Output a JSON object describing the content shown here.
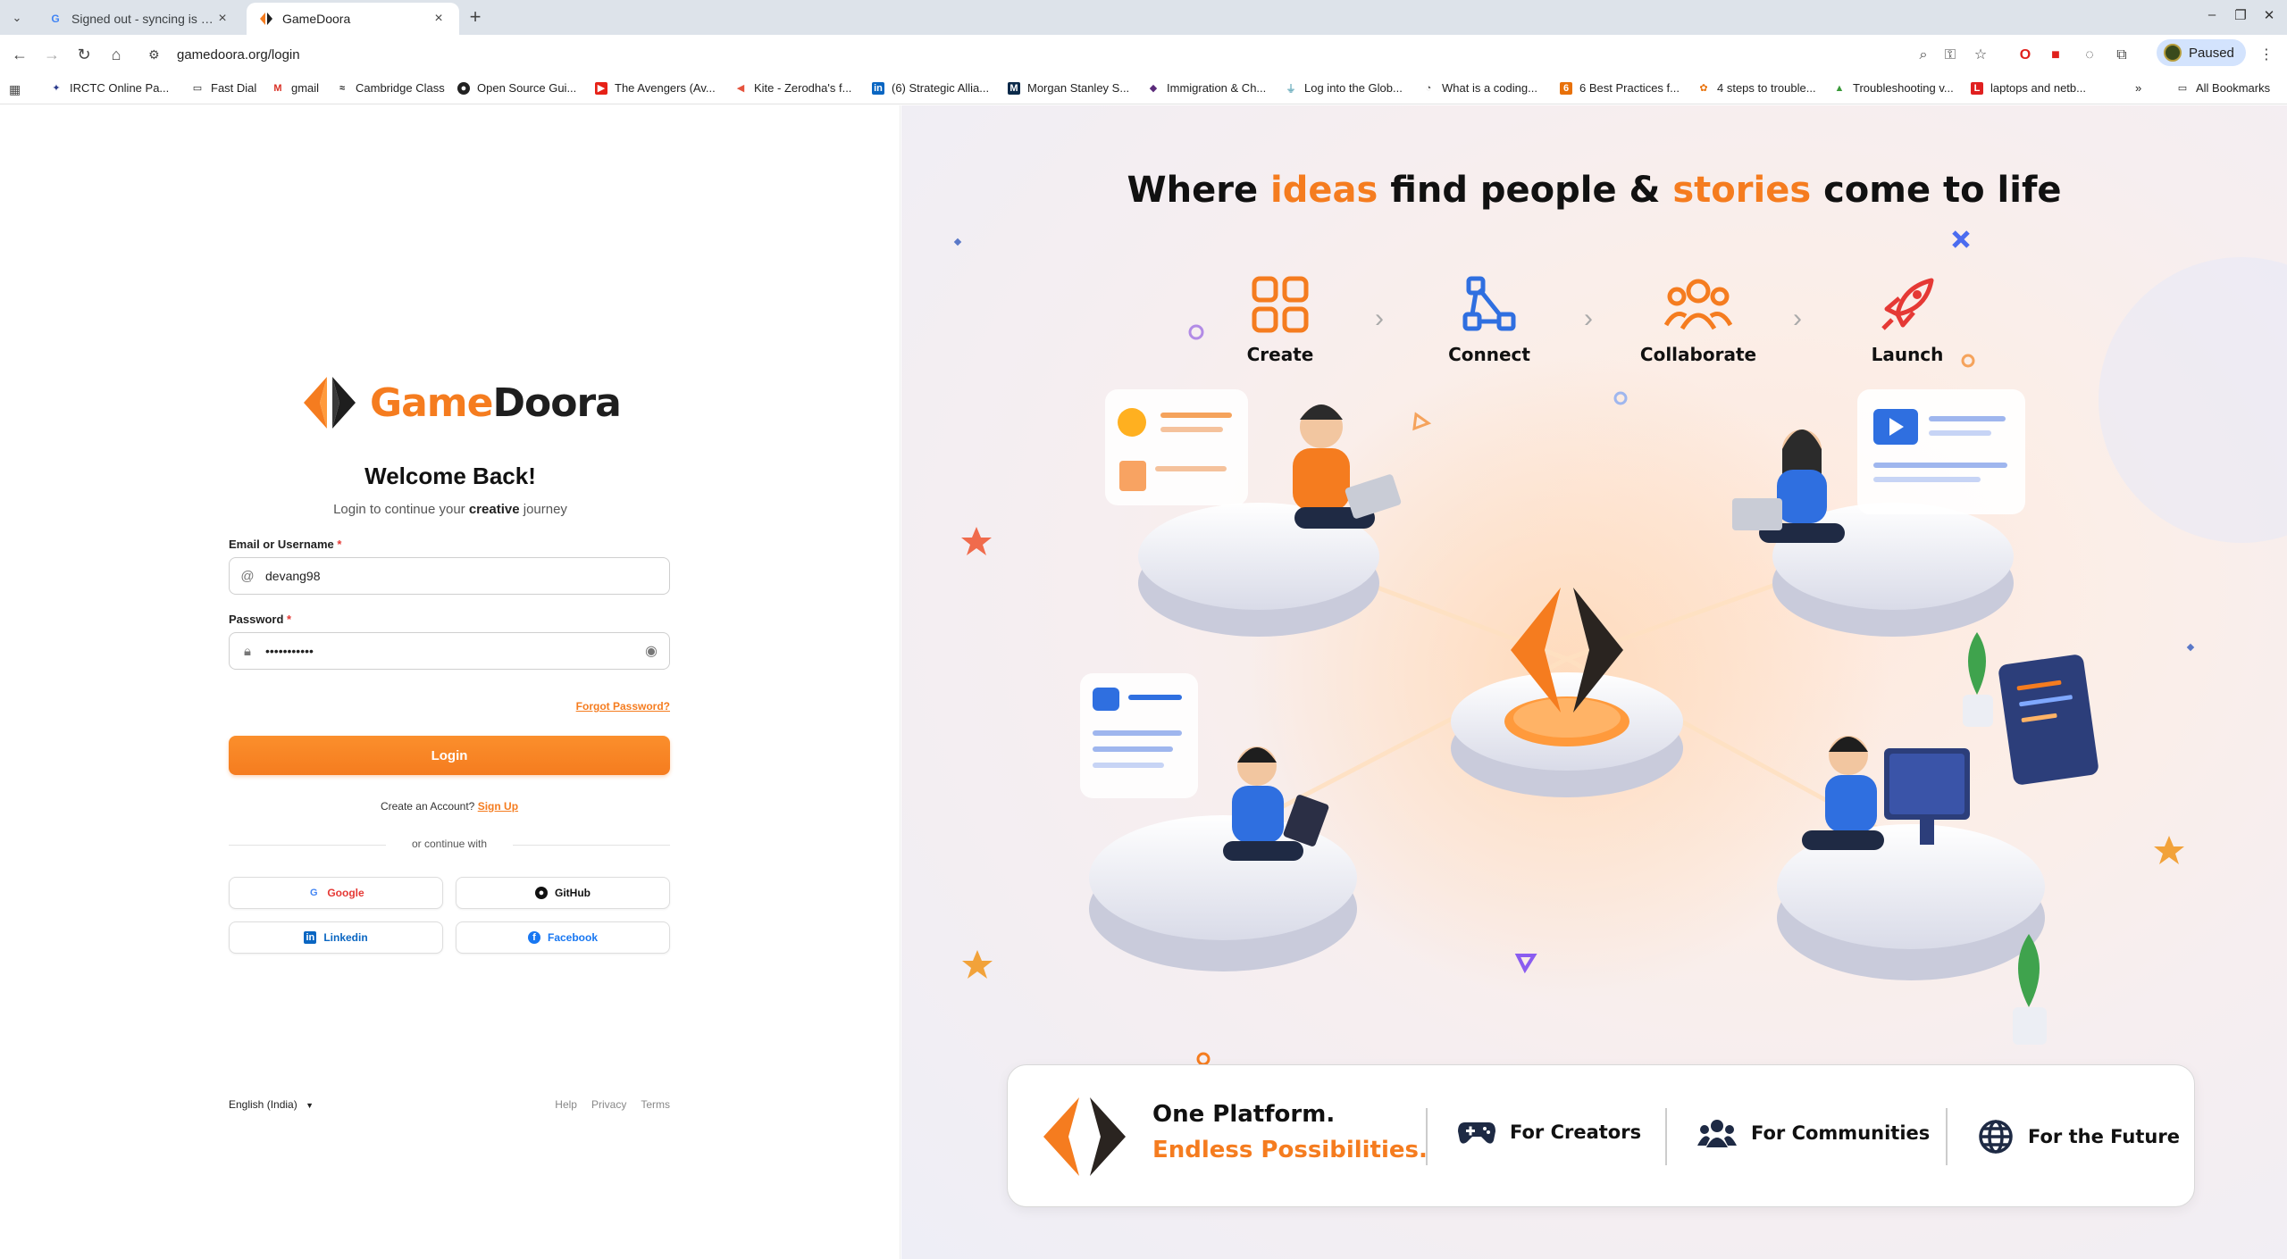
{
  "browser": {
    "tabs": [
      {
        "title": "Signed out - syncing is paused",
        "active": false
      },
      {
        "title": "GameDoora",
        "active": true
      }
    ],
    "url": "gamedoora.org/login",
    "profile_label": "Paused",
    "bookmarks": [
      "IRCTC Online Pa...",
      "Fast Dial",
      "gmail",
      "Cambridge Class",
      "Open Source Gui...",
      "The Avengers (Av...",
      "Kite - Zerodha's f...",
      "(6) Strategic Allia...",
      "Morgan Stanley S...",
      "Immigration & Ch...",
      "Log into the Glob...",
      "What is a coding...",
      "6 Best Practices f...",
      "4 steps to trouble...",
      "Troubleshooting v...",
      "laptops and netb..."
    ],
    "all_bookmarks": "All Bookmarks"
  },
  "login": {
    "logo_game": "Game",
    "logo_doora": "Doora",
    "welcome": "Welcome Back!",
    "subtitle_pre": "Login to continue your ",
    "subtitle_bold": "creative",
    "subtitle_post": " journey",
    "email_label": "Email or Username",
    "email_value": "devang98",
    "password_label": "Password",
    "password_value": "•••••••••••",
    "required_mark": "*",
    "forgot": "Forgot Password?",
    "login_button": "Login",
    "create_text": "Create an Account?",
    "signup": "Sign Up",
    "or_continue": "or continue with",
    "social": [
      "Google",
      "GitHub",
      "Linkedin",
      "Facebook"
    ],
    "language": "English (India)",
    "footer_links": [
      "Help",
      "Privacy",
      "Terms"
    ]
  },
  "hero": {
    "headline_1": "Where ",
    "headline_2": "ideas",
    "headline_3": " find people & ",
    "headline_4": "stories",
    "headline_5": " come to life",
    "steps": [
      "Create",
      "Connect",
      "Collaborate",
      "Launch"
    ],
    "banner_line1": "One Platform.",
    "banner_line2": "Endless Possibilities.",
    "features": [
      "For Creators",
      "For Communities",
      "For the Future"
    ]
  },
  "colors": {
    "brand_orange": "#f57c1f",
    "brand_dark": "#1e1e1e",
    "accent_blue": "#2f6fe0"
  }
}
